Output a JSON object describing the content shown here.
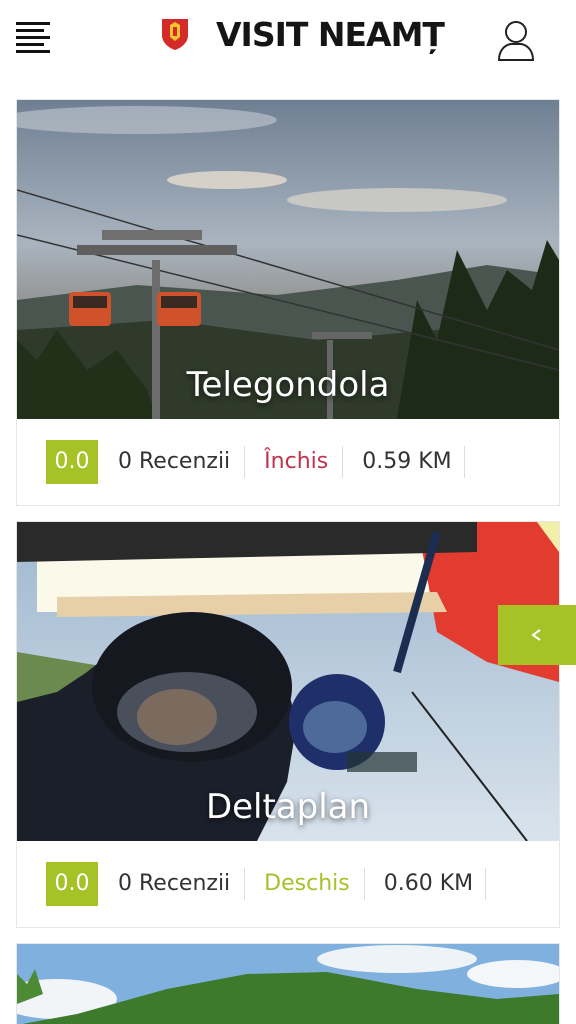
{
  "header": {
    "title": "VISIT NEAMȚ",
    "menu_icon": "hamburger-menu-icon",
    "user_icon": "user-profile-icon",
    "crest_icon": "county-crest-icon"
  },
  "colors": {
    "accent": "#a6c226",
    "closed": "#c0334c",
    "text": "#222222"
  },
  "listings": [
    {
      "title": "Telegondola",
      "rating": "0.0",
      "reviews": "0 Recenzii",
      "status": "Închis",
      "distance": "0.59 KM"
    },
    {
      "title": "Deltaplan",
      "rating": "0.0",
      "reviews": "0 Recenzii",
      "status": "Deschis",
      "distance": "0.60 KM"
    }
  ],
  "side_tab": {
    "icon": "chevron-left-icon"
  }
}
